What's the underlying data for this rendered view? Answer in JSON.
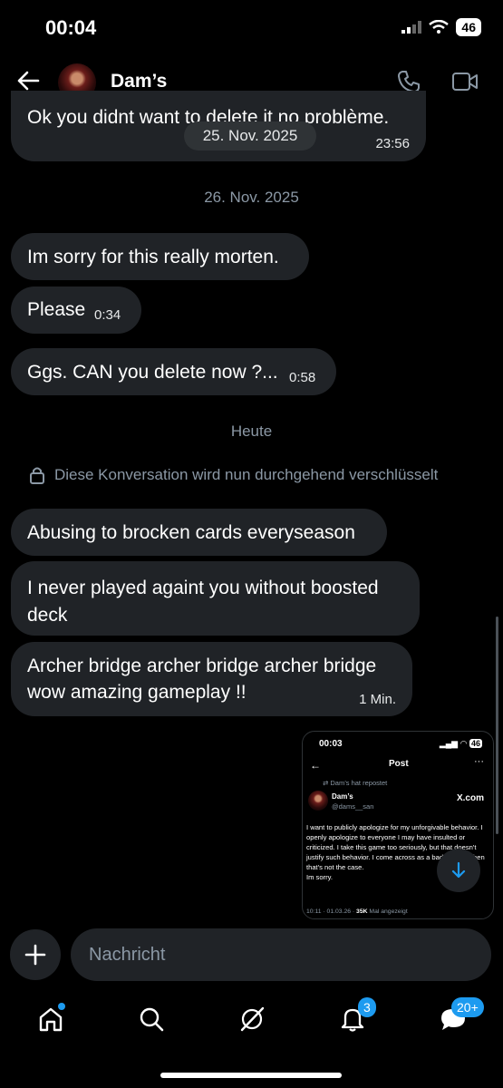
{
  "status": {
    "time": "00:04",
    "battery": "46"
  },
  "header": {
    "title": "Dam’s"
  },
  "messages": {
    "m0": {
      "text": "Ok you didnt want to delete it no problème.",
      "time": "23:56"
    },
    "pill_date": "25. Nov. 2025",
    "date1": "26. Nov. 2025",
    "m1": {
      "text": "Im sorry for this really morten."
    },
    "m2": {
      "text": "Please",
      "time": "0:34"
    },
    "m3": {
      "text": "Ggs. CAN you delete now ?...",
      "time": "0:58"
    },
    "date2": "Heute",
    "encryption": "Diese Konversation wird nun durchgehend verschlüsselt",
    "m4": {
      "text": "Abusing to brocken cards everyseason"
    },
    "m5": {
      "text": "I never played againt you without boosted deck"
    },
    "m6": {
      "text": "Archer bridge archer bridge archer bridge wow amazing gameplay !!",
      "time": "1 Min."
    }
  },
  "attachment": {
    "time": "00:03",
    "status_battery": "46",
    "title": "Post",
    "repost": "Dam’s hat repostet",
    "name": "Dam’s",
    "handle": "@dams__san",
    "site": "X.com",
    "body": "I want to publicly apologize for my unforgivable behavior. I openly apologize to everyone I may have insulted or criticized. I take this game too seriously, but that doesn't justify such behavior. I come across as a bad person when that's not the case.",
    "body2": "Im sorry.",
    "meta_time": "10:11 · 01.03.26 · ",
    "meta_views": "35K",
    "meta_suffix": " Mal angezeigt"
  },
  "composer": {
    "placeholder": "Nachricht"
  },
  "nav": {
    "notifications_badge": "3",
    "messages_badge": "20+"
  },
  "colors": {
    "accent": "#1d9bf0",
    "bubble": "#202327",
    "muted": "#8b98a5"
  }
}
